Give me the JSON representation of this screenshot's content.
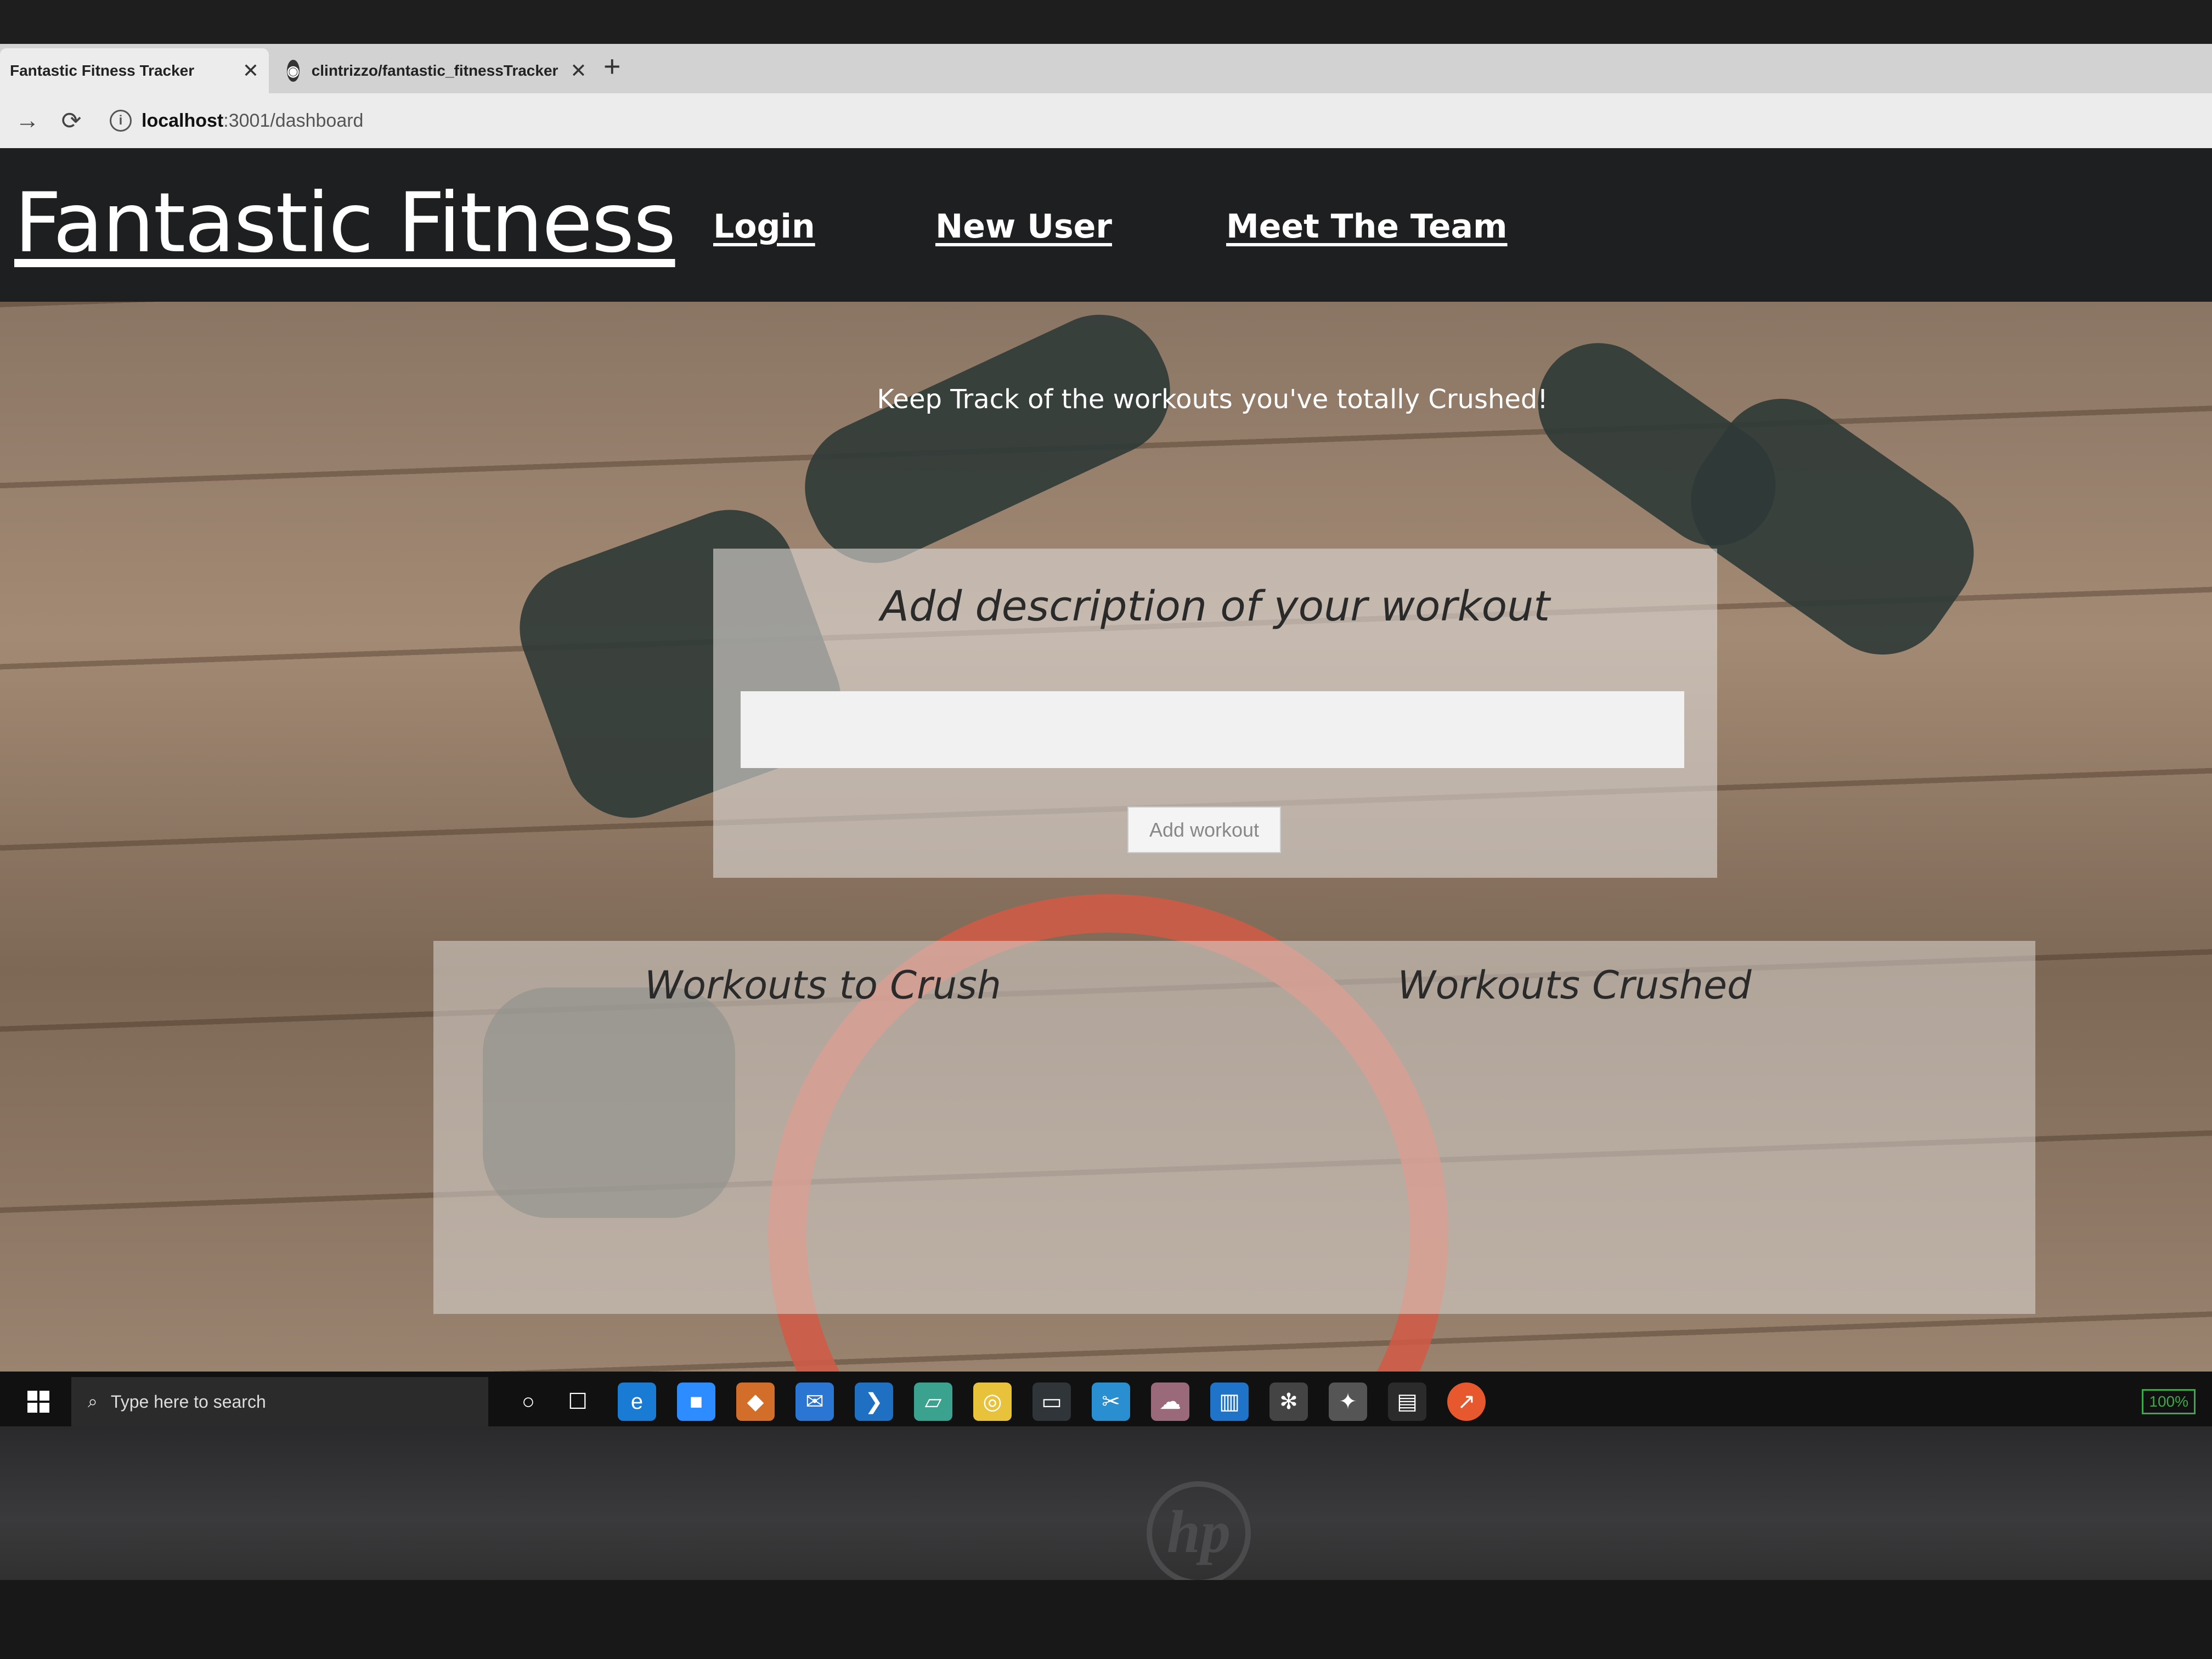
{
  "browser": {
    "tabs": [
      {
        "title": "Fantastic Fitness Tracker",
        "active": true
      },
      {
        "title": "clintrizzo/fantastic_fitnessTracker",
        "active": false
      }
    ],
    "close_glyph": "✕",
    "new_tab_glyph": "+",
    "url_host": "localhost",
    "url_rest": ":3001/dashboard"
  },
  "site": {
    "brand": "Fantastic Fitness",
    "nav": [
      "Login",
      "New User",
      "Meet The Team"
    ],
    "tagline": "Keep Track of the workouts you've totally Crushed!",
    "form": {
      "title": "Add description of your workout",
      "input_value": "",
      "button_label": "Add workout"
    },
    "columns": [
      "Workouts to Crush",
      "Workouts Crushed"
    ]
  },
  "taskbar": {
    "search_placeholder": "Type here to search",
    "battery": "100%",
    "icons": [
      "cortana-icon",
      "task-view-icon",
      "edge-icon",
      "zoom-icon",
      "git-icon",
      "mail-icon",
      "vscode-icon",
      "notepad-icon",
      "chrome-icon",
      "terminal-icon",
      "snipping-icon",
      "cloud-icon",
      "trello-icon",
      "settings-icon",
      "slack-icon",
      "console-icon",
      "postman-icon"
    ]
  },
  "colors": {
    "nav_bg": "#1d1f20",
    "accent_band": "#d25a45",
    "card_bg": "rgba(220,215,212,0.62)"
  }
}
